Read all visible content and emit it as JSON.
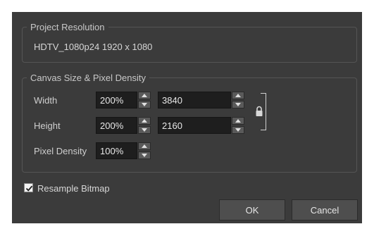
{
  "project_resolution": {
    "title": "Project Resolution",
    "value": "HDTV_1080p24  1920 x 1080"
  },
  "canvas": {
    "title": "Canvas Size & Pixel Density",
    "width": {
      "label": "Width",
      "percent": "200%",
      "pixels": "3840"
    },
    "height": {
      "label": "Height",
      "percent": "200%",
      "pixels": "2160"
    },
    "pixel_density": {
      "label": "Pixel Density",
      "percent": "100%"
    },
    "aspect_locked": true
  },
  "resample_bitmap": {
    "label": "Resample Bitmap",
    "checked": true
  },
  "buttons": {
    "ok": "OK",
    "cancel": "Cancel"
  },
  "icons": [
    "spin-up-icon",
    "spin-down-icon",
    "lock-icon",
    "checkmark-icon"
  ]
}
